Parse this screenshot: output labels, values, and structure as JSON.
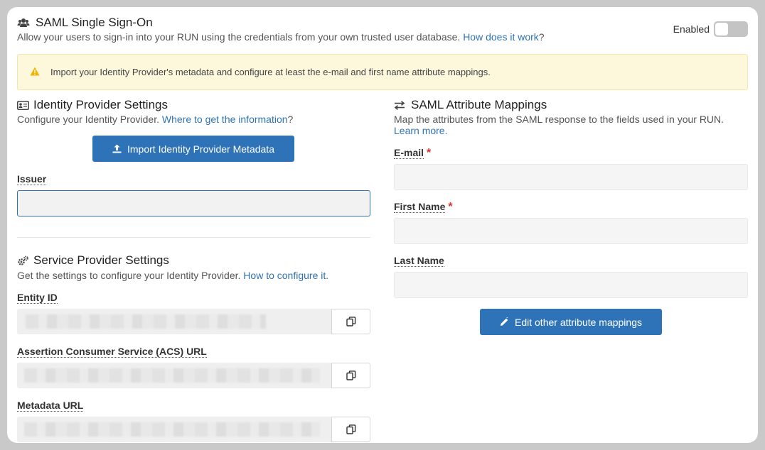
{
  "header": {
    "title": "SAML Single Sign-On",
    "description": "Allow your users to sign-in into your RUN using the credentials from your own trusted user database.",
    "help_link": "How does it work",
    "help_suffix": "?",
    "toggle_label": "Enabled",
    "toggle_on": false
  },
  "alert": {
    "text": "Import your Identity Provider's metadata and configure at least the e-mail and first name attribute mappings."
  },
  "idp": {
    "title": "Identity Provider Settings",
    "description": "Configure your Identity Provider.",
    "link": "Where to get the information",
    "link_suffix": "?",
    "import_button": "Import Identity Provider Metadata",
    "issuer_label": "Issuer",
    "issuer_value": ""
  },
  "sp": {
    "title": "Service Provider Settings",
    "description": "Get the settings to configure your Identity Provider.",
    "link": "How to configure it.",
    "entity_id_label": "Entity ID",
    "acs_label": "Assertion Consumer Service (ACS) URL",
    "metadata_label": "Metadata URL"
  },
  "mappings": {
    "title": "SAML Attribute Mappings",
    "description": "Map the attributes from the SAML response to the fields used in your RUN.",
    "link": "Learn more.",
    "email_label": "E-mail",
    "first_name_label": "First Name",
    "last_name_label": "Last Name",
    "required_mark": "*",
    "edit_button": "Edit other attribute mappings"
  },
  "colors": {
    "accent": "#2e73b8",
    "link": "#2f73b5",
    "alert_bg": "#fdf7dc",
    "warning_icon": "#f0b400",
    "required": "#d9302c"
  }
}
